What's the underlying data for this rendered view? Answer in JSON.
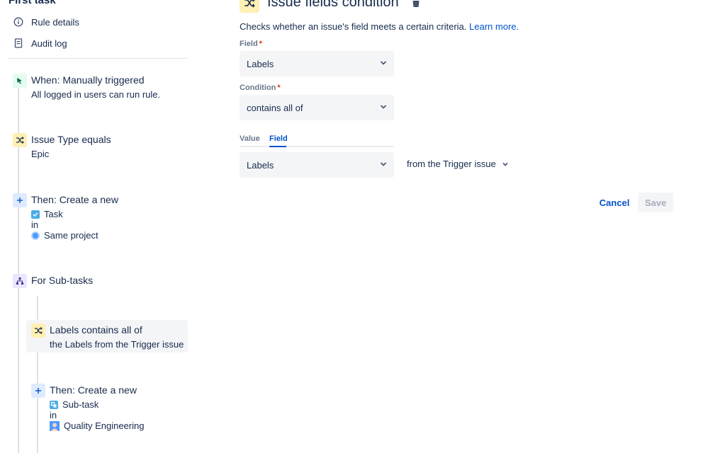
{
  "sidebar": {
    "rule_name": "First task",
    "links": [
      {
        "label": "Rule details",
        "icon": "info-icon"
      },
      {
        "label": "Audit log",
        "icon": "document-icon"
      }
    ],
    "components": [
      {
        "title": "When: Manually triggered",
        "lines": [
          "All logged in users can run rule."
        ],
        "icon": "cursor-click-icon",
        "color": "#36b37e"
      },
      {
        "title": "Issue Type equals",
        "lines": [
          "Epic"
        ],
        "icon": "shuffle-icon",
        "color": "#ff991f"
      },
      {
        "title": "Then: Create a new",
        "item_type": "Task",
        "in": "in",
        "project": "Same project",
        "icon": "plus-icon",
        "color": "#0052cc"
      },
      {
        "title": "For Sub-tasks",
        "icon": "hierarchy-icon",
        "color": "#6554c0"
      },
      {
        "title": "Labels contains all of",
        "lines": [
          "the Labels from the Trigger issue"
        ],
        "icon": "shuffle-icon",
        "color": "#ff991f"
      },
      {
        "title": "Then: Create a new",
        "item_type": "Sub-task",
        "in": "in",
        "project": "Quality Engineering",
        "icon": "plus-icon",
        "color": "#0052cc"
      }
    ]
  },
  "panel": {
    "title": "Issue fields condition",
    "description": "Checks whether an issue's field meets a certain criteria.",
    "learn_more": "Learn more.",
    "field_label": "Field",
    "field_value": "Labels",
    "condition_label": "Condition",
    "condition_value": "contains all of",
    "required_mark": "*",
    "tabs": [
      "Value",
      "Field"
    ],
    "active_tab": "Field",
    "value_field": "Labels",
    "source": "from the Trigger issue",
    "cancel_label": "Cancel",
    "save_label": "Save"
  },
  "colors": {
    "accent": "#0052cc",
    "required": "#de350b",
    "condition_badge": "#fff0b3",
    "trigger_badge": "#e3fcef",
    "action_badge": "#deebff",
    "branch_badge": "#eae6ff"
  }
}
